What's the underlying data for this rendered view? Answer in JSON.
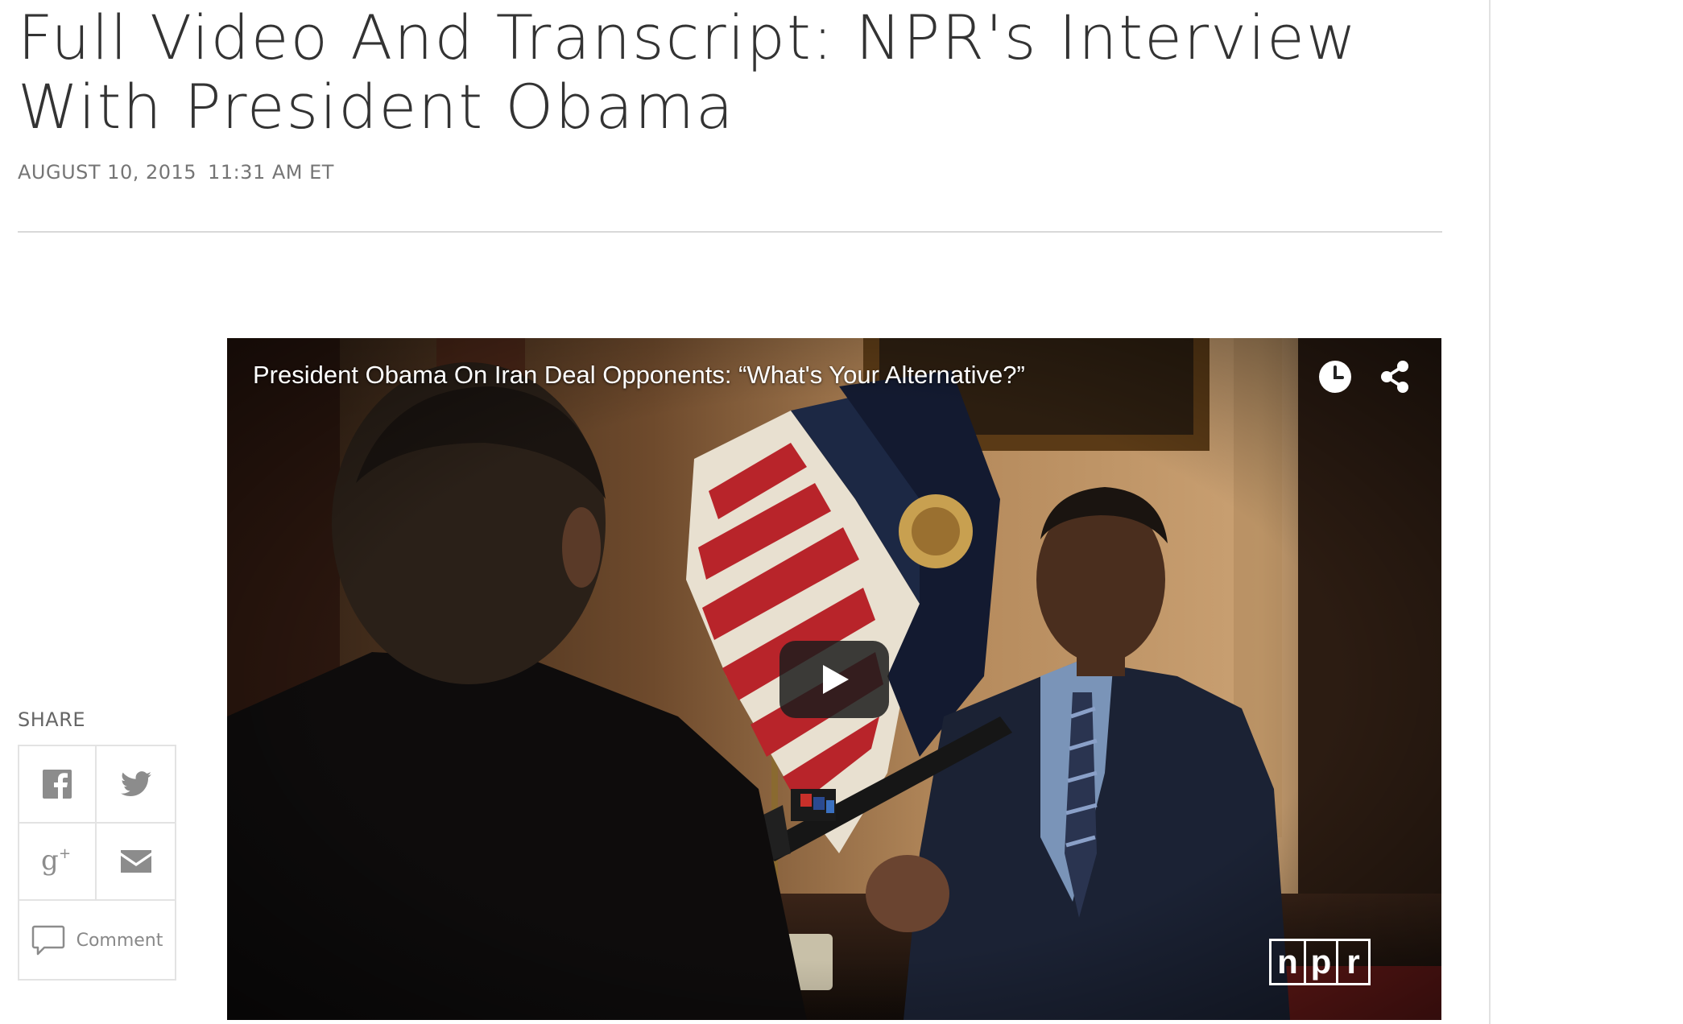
{
  "article": {
    "headline": "Full Video And Transcript: NPR's Interview With President Obama",
    "date": "AUGUST 10, 2015",
    "time": "11:31 AM ET"
  },
  "share": {
    "label": "SHARE",
    "buttons": [
      {
        "icon": "facebook-icon"
      },
      {
        "icon": "twitter-icon"
      },
      {
        "icon": "google-plus-icon"
      },
      {
        "icon": "email-icon"
      }
    ],
    "comment_label": "Comment"
  },
  "video": {
    "title": "President Obama On Iran Deal Opponents: “What's Your Alternative?”",
    "controls": [
      "clock-icon",
      "share-icon",
      "play-icon"
    ],
    "watermark": [
      "n",
      "p",
      "r"
    ]
  }
}
